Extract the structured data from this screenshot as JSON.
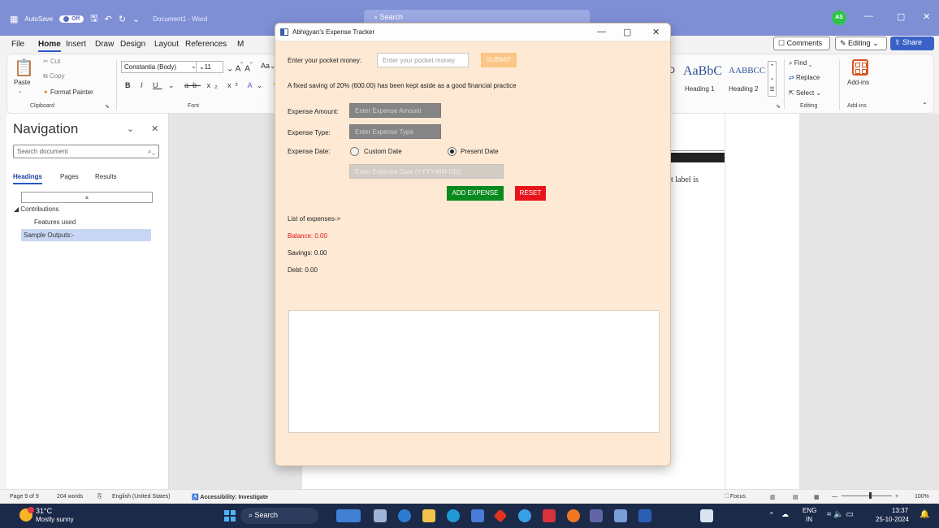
{
  "word": {
    "autosave_label": "AutoSave",
    "autosave_state": "Off",
    "doc_title": "Document1 - Word",
    "search_placeholder": "Search",
    "avatar_initials": "AS",
    "tabs": [
      "File",
      "Home",
      "Insert",
      "Draw",
      "Design",
      "Layout",
      "References",
      "M"
    ],
    "comments_label": "Comments",
    "editing_label": "Editing",
    "share_label": "Share"
  },
  "ribbon": {
    "clipboard": {
      "cut": "Cut",
      "copy": "Copy",
      "paste": "Paste",
      "format_painter": "Format Painter",
      "group_label": "Clipboard"
    },
    "font": {
      "font_name": "Constantia (Body)",
      "font_size": "11",
      "group_label": "Font",
      "case_label": "Aa"
    },
    "styles": {
      "style1_sample": "AaBbC",
      "style2_sample": "AABBCC",
      "style1_name": "Heading 1",
      "style2_name": "Heading 2"
    },
    "editing": {
      "find": "Find",
      "replace": "Replace",
      "select": "Select",
      "group_label": "Editing"
    },
    "addins": {
      "label": "Add-ins",
      "group_label": "Add-ins"
    }
  },
  "navigation": {
    "title": "Navigation",
    "search_placeholder": "Search document",
    "tabs": [
      "Headings",
      "Pages",
      "Results"
    ],
    "items": [
      "Contributions",
      "Features used",
      "Sample Outputs:-"
    ]
  },
  "document": {
    "snippet": "t label is"
  },
  "app": {
    "title": "Abhigyan's Expense Tracker",
    "pocket_label": "Enter your pocket money:",
    "pocket_placeholder": "Enter your pocket money",
    "submit_label": "SUBMIT",
    "savings_note": "A fixed saving of 20% (600.00) has been kept aside as a good financial practice",
    "amount_label": "Expense Amount:",
    "amount_placeholder": "Enter Expense Amount",
    "type_label": "Expense Type:",
    "type_placeholder": "Enter Expense Type",
    "date_label": "Expense Date:",
    "custom_date_label": "Custom Date",
    "present_date_label": "Present Date",
    "date_placeholder": "Enter Expense Date (YYYY-MM-DD)",
    "add_label": "ADD EXPENSE",
    "reset_label": "RESET",
    "list_label": "List of expenses->",
    "balance": "Balance: 0.00",
    "savings": "Savings: 0.00",
    "debt": "Debt: 0.00",
    "balance_color": "#e8141c"
  },
  "statusbar": {
    "page": "Page 9 of 9",
    "words": "204 words",
    "language": "English (United States)",
    "accessibility": "Accessibility: Investigate",
    "focus": "Focus",
    "zoom": "100%"
  },
  "taskbar": {
    "temperature": "31°C",
    "weather": "Mostly sunny",
    "search": "Search",
    "lang": "ENG",
    "region": "IN",
    "time": "13:37",
    "date": "25-10-2024"
  }
}
